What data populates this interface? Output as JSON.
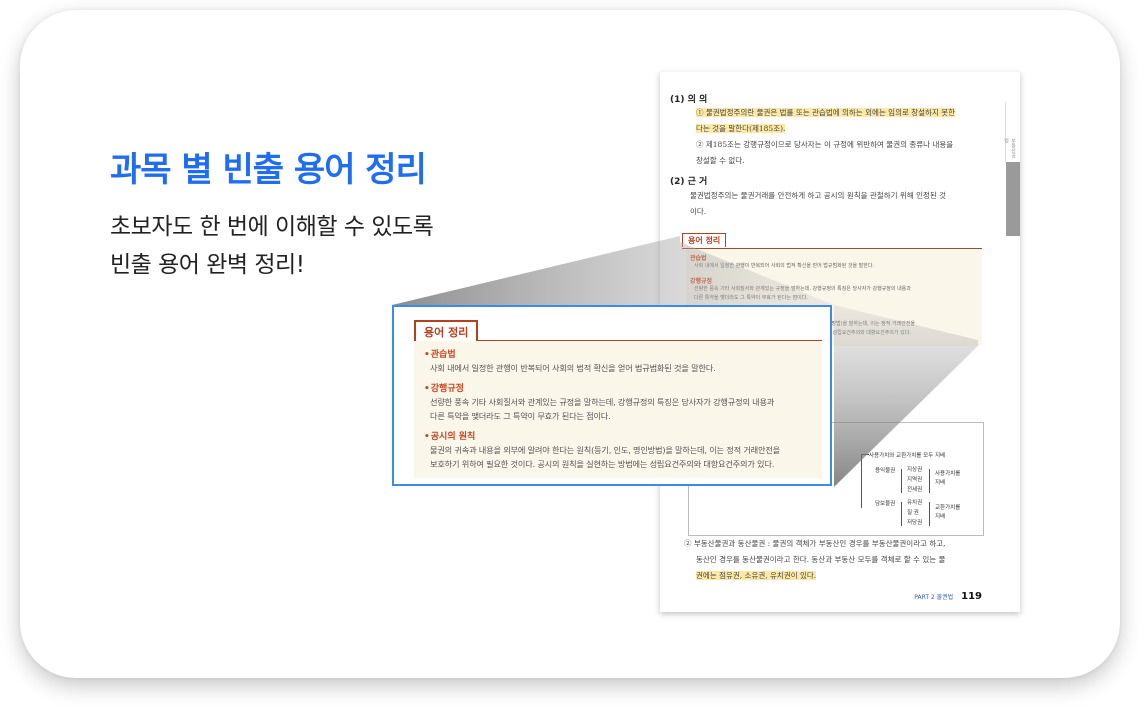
{
  "promo": {
    "headline": "과목 별 빈출 용어 정리",
    "desc_line1": "초보자도 한 번에 이해할 수 있도록",
    "desc_line2": "빈출 용어 완벽 정리!"
  },
  "page": {
    "sidebar_top": "부동산공법",
    "sidebar_tab": "부동산 공시에관한법령",
    "h1": "(1) 의 의",
    "p1a": "① 물권법정주의란 물권은 법률 또는 관습법에 의하는 외에는 임의로 창설하지 못한",
    "p1b": "다는 것을 말한다(제185조).",
    "p2a": "② 제185조는 강행규정이므로 당사자는 이 규정에 위반하여 물권의 종류나 내용을",
    "p2b": "창설할 수 없다.",
    "h2": "(2) 근 거",
    "p3a": "물권법정주의는 물권거래를 안전하게 하고 공시의 원칙을 관철하기 위해 인정된 것",
    "p3b": "이다.",
    "p4a": "② 부동산물권과 동산물권 : 물권의 객체가 부동산인 경우를 부동산물권이라고 하고,",
    "p4b": "동산인 경우를 동산물권이라고 한다. 동산과 부동산 모두를 객체로 할 수 있는 물",
    "p4c": "권에는 점유권, 소유권, 유치권이 있다.",
    "footer_part": "PART 2  물권법",
    "footer_page": "119",
    "diagram": {
      "a": "사용가치와 교환가치를 모두 지배",
      "b": "용익물권",
      "c1": "지상권",
      "c2": "지역권",
      "c3": "전세권",
      "c_note": "사용가치를",
      "c_note2": "지배",
      "d": "담보물권",
      "e1": "유치권",
      "e2": "질 권",
      "e3": "저당권",
      "e_note": "교환가치를",
      "e_note2": "지배"
    }
  },
  "glossary": {
    "title": "용어 정리",
    "items": [
      {
        "term": "관습법",
        "def1": "사회 내에서 일정한 관행이 반복되어 사회의 법적 확신을 얻어 법규범화된 것을 말한다.",
        "def2": ""
      },
      {
        "term": "강행규정",
        "def1": "선량한 풍속 기타 사회질서와 관계있는 규정을 말하는데, 강행규정의 특징은 당사자가 강행규정의 내용과",
        "def2": "다른 특약을 맺더라도 그 특약이 무효가 된다는 점이다."
      },
      {
        "term": "공시의 원칙",
        "def1": "물권의 귀속과 내용을 외부에 알려야 한다는 원칙(등기, 인도, 명인방법)을 말하는데, 이는 정적 거래안전을",
        "def2": "보호하기 위하여 필요한 것이다. 공시의 원칙을 실현하는 방법에는 성립요건주의와 대항요건주의가 있다."
      }
    ]
  }
}
